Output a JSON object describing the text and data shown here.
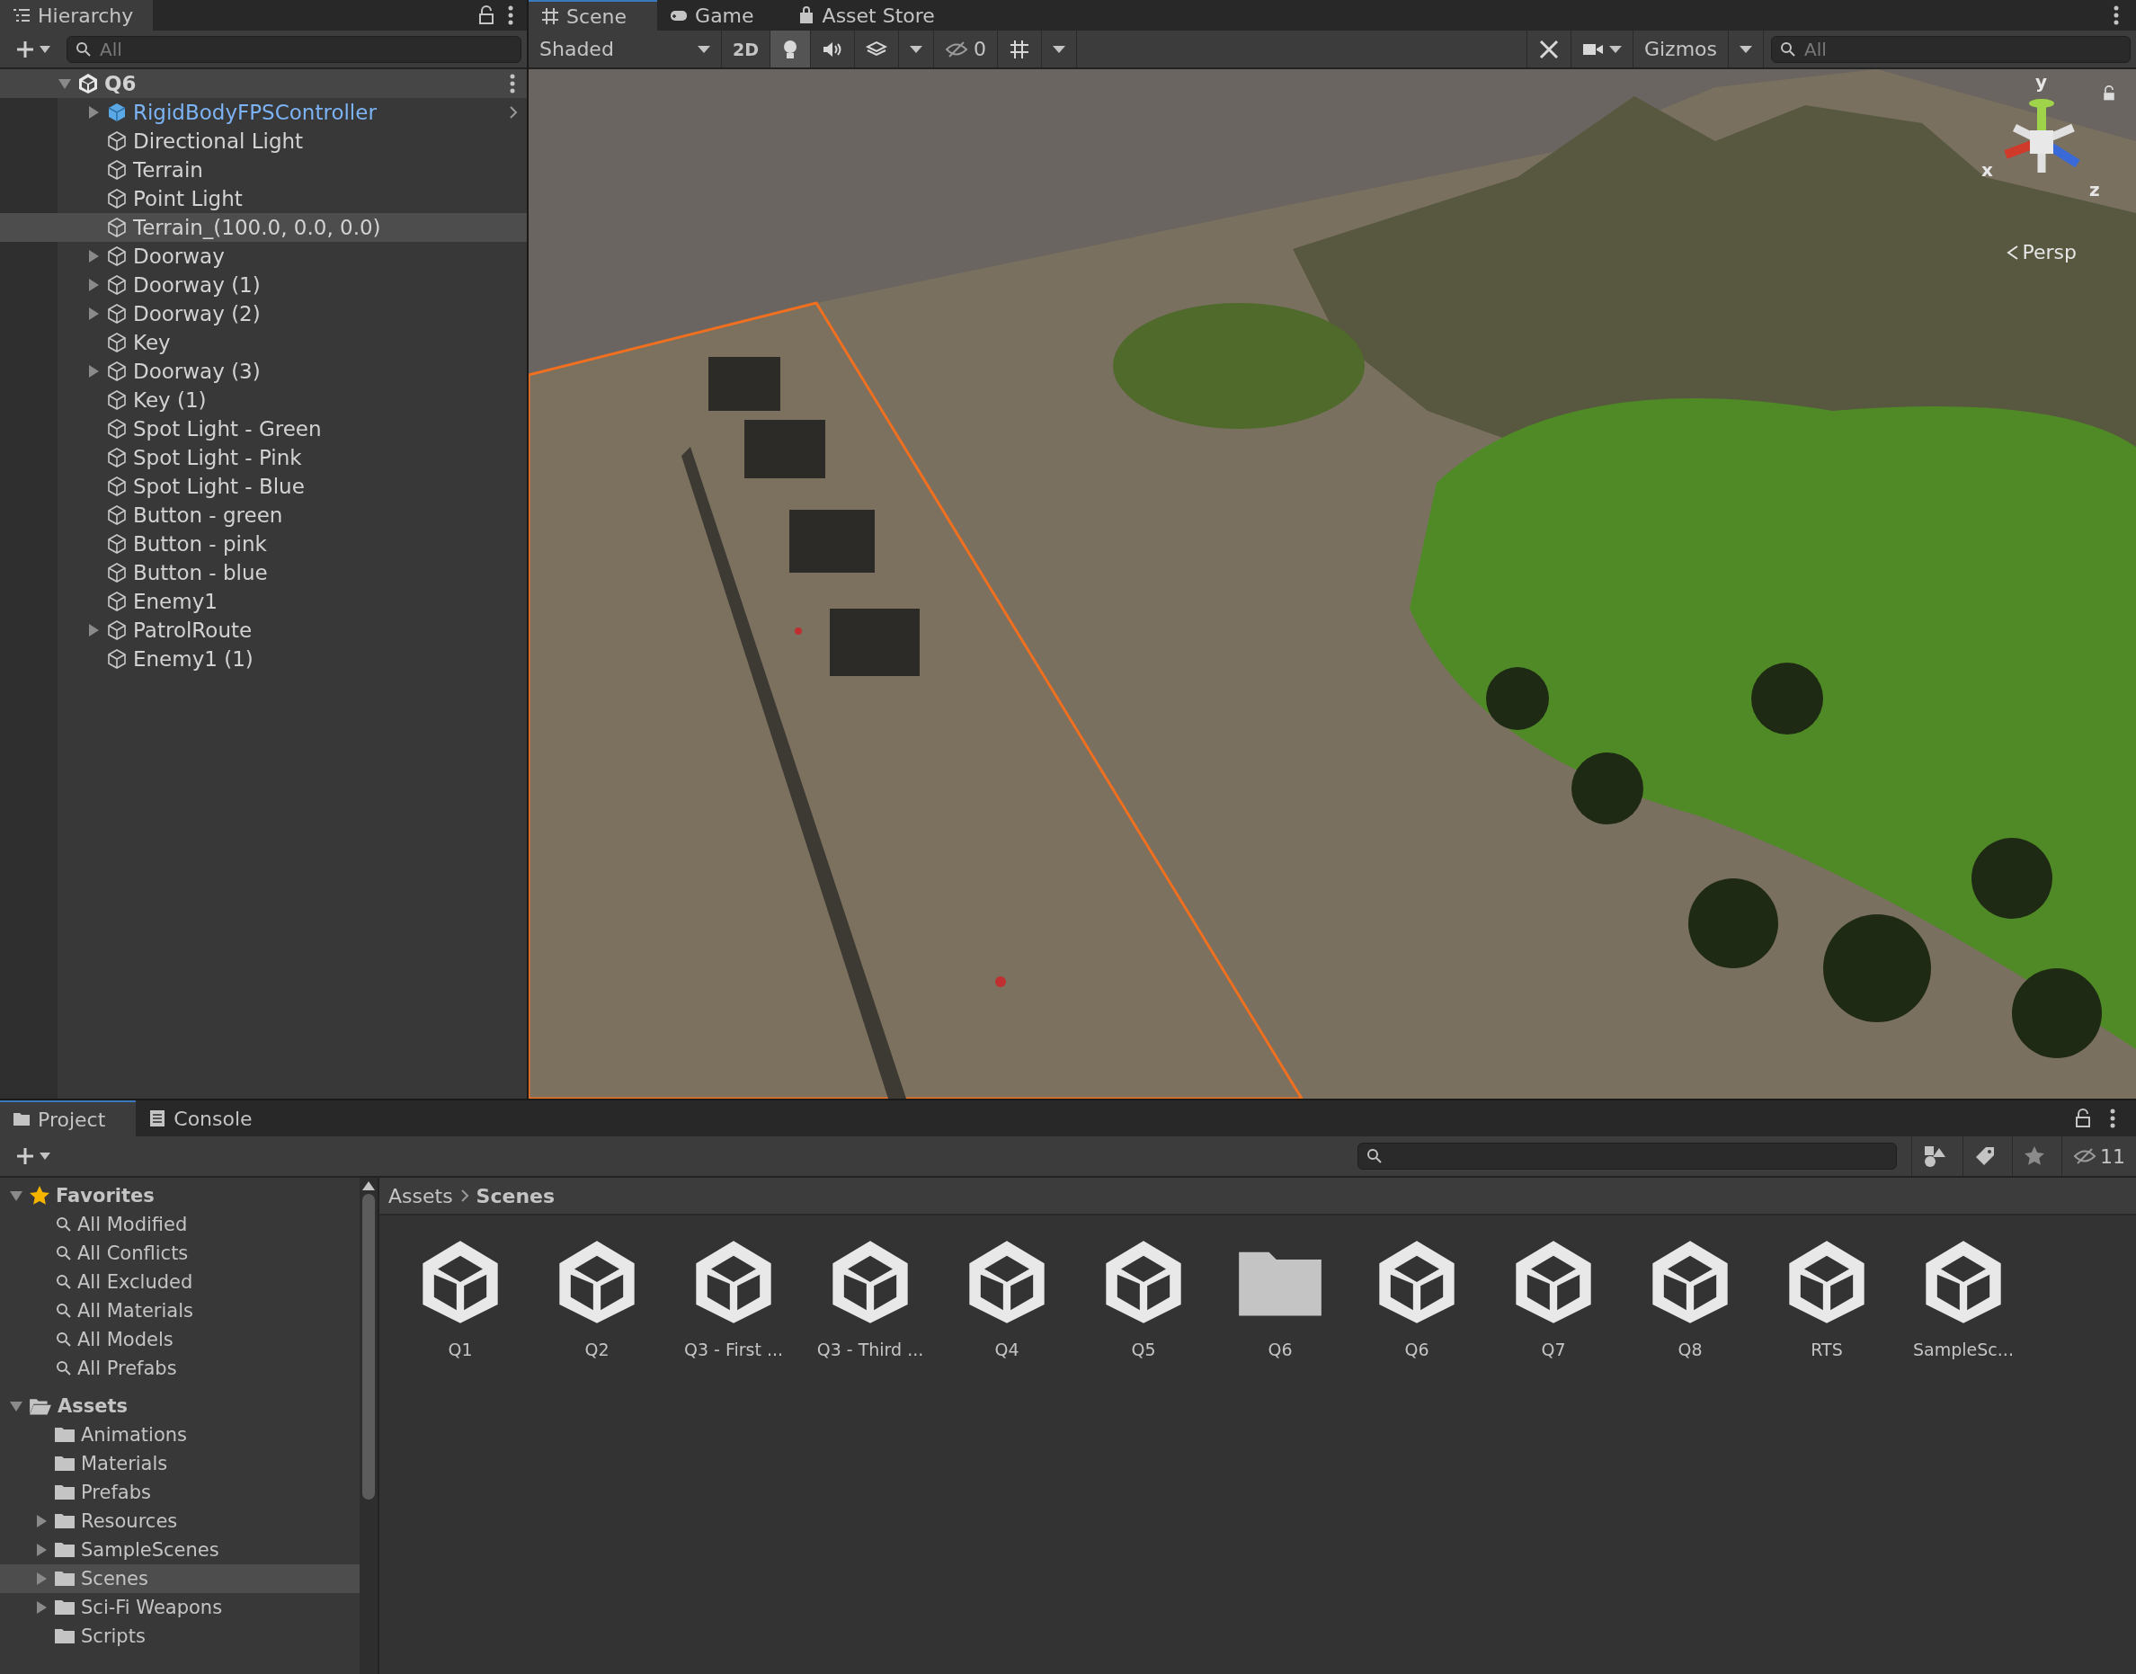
{
  "hierarchy": {
    "tab": "Hierarchy",
    "search": {
      "placeholder": "All"
    },
    "scene": {
      "name": "Q6",
      "expanded": true
    },
    "items": [
      {
        "name": "RigidBodyFPSController",
        "kind": "prefab",
        "expanded": false,
        "selected": false
      },
      {
        "name": "Directional Light",
        "kind": "object",
        "selected": false
      },
      {
        "name": "Terrain",
        "kind": "object",
        "selected": false
      },
      {
        "name": "Point Light",
        "kind": "object",
        "selected": false
      },
      {
        "name": "Terrain_(100.0, 0.0, 0.0)",
        "kind": "object",
        "selected": true
      },
      {
        "name": "Doorway",
        "kind": "object",
        "expanded": false,
        "selected": false
      },
      {
        "name": "Doorway (1)",
        "kind": "object",
        "expanded": false,
        "selected": false
      },
      {
        "name": "Doorway (2)",
        "kind": "object",
        "expanded": false,
        "selected": false
      },
      {
        "name": "Key",
        "kind": "object",
        "selected": false
      },
      {
        "name": "Doorway (3)",
        "kind": "object",
        "expanded": false,
        "selected": false
      },
      {
        "name": "Key (1)",
        "kind": "object",
        "selected": false
      },
      {
        "name": "Spot Light - Green",
        "kind": "object",
        "selected": false
      },
      {
        "name": "Spot Light - Pink",
        "kind": "object",
        "selected": false
      },
      {
        "name": "Spot Light - Blue",
        "kind": "object",
        "selected": false
      },
      {
        "name": "Button - green",
        "kind": "object",
        "selected": false
      },
      {
        "name": "Button  - pink",
        "kind": "object",
        "selected": false
      },
      {
        "name": "Button - blue",
        "kind": "object",
        "selected": false
      },
      {
        "name": "Enemy1",
        "kind": "object",
        "selected": false
      },
      {
        "name": "PatrolRoute",
        "kind": "object",
        "expanded": false,
        "selected": false
      },
      {
        "name": "Enemy1 (1)",
        "kind": "object",
        "selected": false
      }
    ]
  },
  "scene_tabs": [
    {
      "label": "Scene",
      "kind": "scene",
      "selected": true
    },
    {
      "label": "Game",
      "kind": "game",
      "selected": false
    },
    {
      "label": "Asset Store",
      "kind": "store",
      "selected": false
    }
  ],
  "scene_toolbar": {
    "shading": "Shaded",
    "mode_2d": {
      "label": "2D",
      "on": false
    },
    "lighting": {
      "on": true
    },
    "audio": {
      "on": false
    },
    "effects": {
      "on": false
    },
    "hidden_count": "0",
    "gizmos": "Gizmos",
    "search": {
      "placeholder": "All"
    }
  },
  "scene_view": {
    "gizmo": {
      "y": "y",
      "x": "x",
      "z": "z"
    },
    "projection": "Persp"
  },
  "project_tabs": [
    {
      "label": "Project",
      "kind": "project",
      "selected": true
    },
    {
      "label": "Console",
      "kind": "console",
      "selected": false
    }
  ],
  "project_toolbar": {
    "hidden_count": "11"
  },
  "project_tree": [
    {
      "label": "Favorites",
      "kind": "favorites",
      "expanded": true,
      "selected": false,
      "children": [
        {
          "label": "All Modified",
          "kind": "search",
          "selected": false
        },
        {
          "label": "All Conflicts",
          "kind": "search",
          "selected": false
        },
        {
          "label": "All Excluded",
          "kind": "search",
          "selected": false
        },
        {
          "label": "All Materials",
          "kind": "search",
          "selected": false
        },
        {
          "label": "All Models",
          "kind": "search",
          "selected": false
        },
        {
          "label": "All Prefabs",
          "kind": "search",
          "selected": false
        }
      ]
    },
    {
      "label": "Assets",
      "kind": "folder",
      "expanded": true,
      "selected": false,
      "children": [
        {
          "label": "Animations",
          "kind": "folder",
          "selected": false
        },
        {
          "label": "Materials",
          "kind": "folder",
          "selected": false
        },
        {
          "label": "Prefabs",
          "kind": "folder",
          "selected": false
        },
        {
          "label": "Resources",
          "kind": "folder",
          "expanded": false,
          "selected": false
        },
        {
          "label": "SampleScenes",
          "kind": "folder",
          "expanded": false,
          "selected": false
        },
        {
          "label": "Scenes",
          "kind": "folder",
          "expanded": false,
          "selected": true
        },
        {
          "label": "Sci-Fi Weapons",
          "kind": "folder",
          "expanded": false,
          "selected": false
        },
        {
          "label": "Scripts",
          "kind": "folder",
          "selected": false
        }
      ]
    }
  ],
  "breadcrumb": [
    "Assets",
    "Scenes"
  ],
  "assets": [
    {
      "label": "Q1",
      "kind": "scene"
    },
    {
      "label": "Q2",
      "kind": "scene"
    },
    {
      "label": "Q3 - First ...",
      "kind": "scene"
    },
    {
      "label": "Q3 - Third ...",
      "kind": "scene"
    },
    {
      "label": "Q4",
      "kind": "scene"
    },
    {
      "label": "Q5",
      "kind": "scene"
    },
    {
      "label": "Q6",
      "kind": "folder"
    },
    {
      "label": "Q6",
      "kind": "scene"
    },
    {
      "label": "Q7",
      "kind": "scene"
    },
    {
      "label": "Q8",
      "kind": "scene"
    },
    {
      "label": "RTS",
      "kind": "scene"
    },
    {
      "label": "SampleSc...",
      "kind": "scene"
    }
  ]
}
